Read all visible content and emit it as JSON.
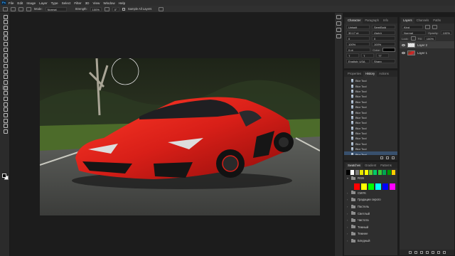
{
  "app": {
    "logo": "Ps"
  },
  "menu": [
    "File",
    "Edit",
    "Image",
    "Layer",
    "Type",
    "Select",
    "Filter",
    "3D",
    "View",
    "Window",
    "Help"
  ],
  "options_bar": {
    "mode_label": "Mode:",
    "mode_value": "Normal",
    "strength_label": "Strength:",
    "strength_value": "100%",
    "angle_value": "0°",
    "sample_all_layers_label": "Sample All Layers",
    "sample_all_layers_checked": true
  },
  "tools": [
    "move-tool",
    "marquee-tool",
    "lasso-tool",
    "quick-select-tool",
    "crop-tool",
    "frame-tool",
    "eyedropper-tool",
    "healing-tool",
    "brush-tool",
    "clone-stamp-tool",
    "history-brush-tool",
    "eraser-tool",
    "gradient-tool",
    "blur-tool",
    "dodge-tool",
    "pen-tool",
    "type-tool",
    "path-select-tool",
    "rectangle-tool",
    "hand-tool",
    "zoom-tool",
    "more-tools"
  ],
  "character_panel": {
    "tabs": [
      "Character",
      "Paragraph",
      "Info"
    ],
    "font_family": "Unispit",
    "font_style": "SemiBold",
    "font_size": "30,17 pt",
    "leading": "(Auto)",
    "kerning": "0",
    "tracking": "0",
    "vertical_scale": "100%",
    "horizontal_scale": "100%",
    "baseline": "0 pt",
    "color_label": "Color:",
    "language": "English: USA",
    "antialias": "Sharp"
  },
  "history_panel": {
    "tabs": [
      "Properties",
      "History",
      "Actions"
    ],
    "items": [
      "Blur Tool",
      "Blur Tool",
      "Blur Tool",
      "Blur Tool",
      "Blur Tool",
      "Blur Tool",
      "Blur Tool",
      "Blur Tool",
      "Blur Tool",
      "Blur Tool",
      "Blur Tool",
      "Blur Tool",
      "Blur Tool",
      "Blur Tool",
      "Blur Tool"
    ],
    "selected_index": 14
  },
  "swatches_panel": {
    "tabs": [
      "Swatches",
      "Gradient",
      "Patterns"
    ],
    "recent_colors": [
      "#000000",
      "#ffffff",
      "#7a7a7a",
      "#e6e600",
      "#ffff00",
      "#66cc33",
      "#00cc66",
      "#33cc33",
      "#00a651",
      "#009900",
      "#ffcc00"
    ],
    "folders": [
      {
        "name": "RGB",
        "colors": [
          "#ff0000",
          "#ffff00",
          "#00ff00",
          "#00ffff",
          "#0000ff",
          "#ff00ff"
        ]
      },
      {
        "name": "CMYK"
      },
      {
        "name": "Градации серого"
      },
      {
        "name": "Пастель"
      },
      {
        "name": "Светлый"
      },
      {
        "name": "Чистота"
      },
      {
        "name": "Темный"
      },
      {
        "name": "Темнее"
      },
      {
        "name": "Бледный"
      }
    ]
  },
  "layers_panel": {
    "tabs": [
      "Layers",
      "Channels",
      "Paths"
    ],
    "filter": "Kind",
    "blend_mode": "Normal",
    "opacity_label": "Opacity:",
    "opacity": "100%",
    "lock_label": "Lock:",
    "fill_label": "Fill:",
    "fill": "100%",
    "layers": [
      {
        "name": "Layer 2",
        "selected": true,
        "thumb": "checker"
      },
      {
        "name": "Layer 1",
        "selected": false,
        "thumb": "car"
      }
    ]
  },
  "colors": {
    "accent": "#38506d",
    "car_red": "#d81f18"
  }
}
